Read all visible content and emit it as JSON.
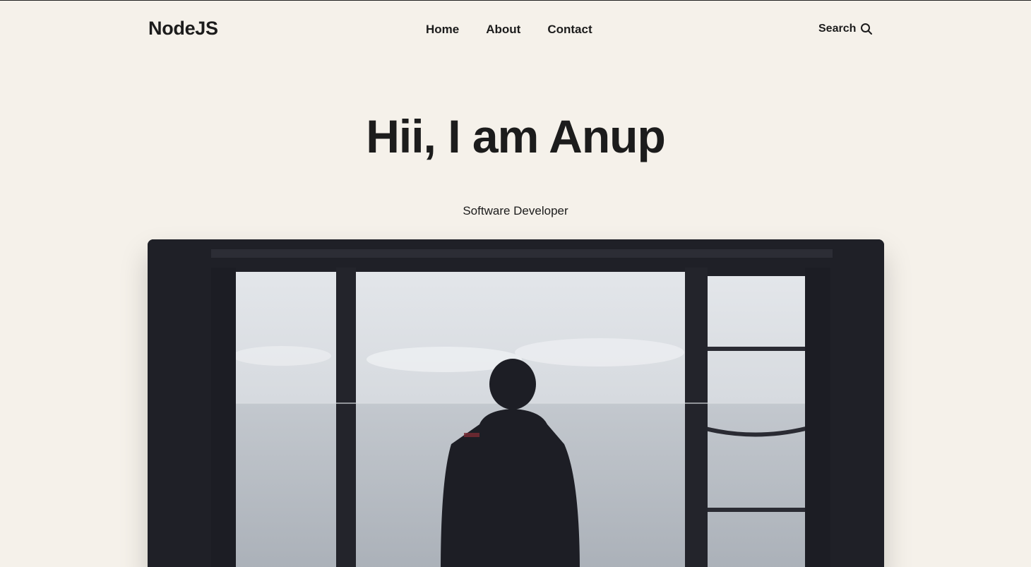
{
  "header": {
    "logo": "NodeJS",
    "nav": [
      "Home",
      "About",
      "Contact"
    ],
    "search_label": "Search"
  },
  "hero": {
    "title": "Hii, I am Anup",
    "subtitle": "Software Developer",
    "image_icon": "person-at-window-photo"
  },
  "colors": {
    "background": "#f5f1ea",
    "text": "#1c1c1c",
    "frame_dark": "#1f2027"
  }
}
